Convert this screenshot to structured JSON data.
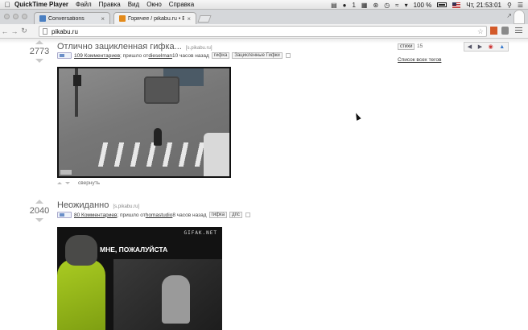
{
  "menubar": {
    "app_name": "QuickTime Player",
    "items": [
      "Файл",
      "Правка",
      "Вид",
      "Окно",
      "Справка"
    ],
    "battery": "100 %",
    "clock": "Чт, 21:53:01",
    "status_icons": [
      "document-icon",
      "onepassword-icon",
      "number-1-icon",
      "vm-icon",
      "bluetooth-icon",
      "clock-icon",
      "wifi-icon",
      "volume-icon",
      "battery-icon",
      "us-flag-icon",
      "search-icon",
      "list-icon"
    ]
  },
  "tabs": [
    {
      "label": "Conversations",
      "favicon_color": "#4a7fc1"
    },
    {
      "label": "Горячее / pikabu.ru • Все",
      "favicon_color": "#e38a1a"
    }
  ],
  "toolbar": {
    "url": "pikabu.ru"
  },
  "stories": [
    {
      "rating": "2773",
      "title": "Отлично зацикленная гифка...",
      "source": "[s.pikabu.ru]",
      "comments": "109 Комментариев",
      "posted_by_prefix": "; пришло от ",
      "author": "dieselman",
      "time": " 10 часов назад",
      "tags": [
        "гифка",
        "Зацикленные Гифки"
      ],
      "collapse": "свернуть"
    },
    {
      "rating": "2040",
      "title": "Неожиданно",
      "source": "[s.pikabu.ru]",
      "comments": "80 Комментариев",
      "posted_by_prefix": "; пришло от ",
      "author": "homastudio",
      "time": " 8 часов назад",
      "tags": [
        "гифка",
        "дпс"
      ],
      "gif_watermark": "GIFAK.NET",
      "gif_caption": "МНЕ, ПОЖАЛУЙСТА"
    }
  ],
  "sidebar": {
    "tag": "стихи",
    "tag_count": "15",
    "all_tags_link": "Список всех тегов"
  }
}
